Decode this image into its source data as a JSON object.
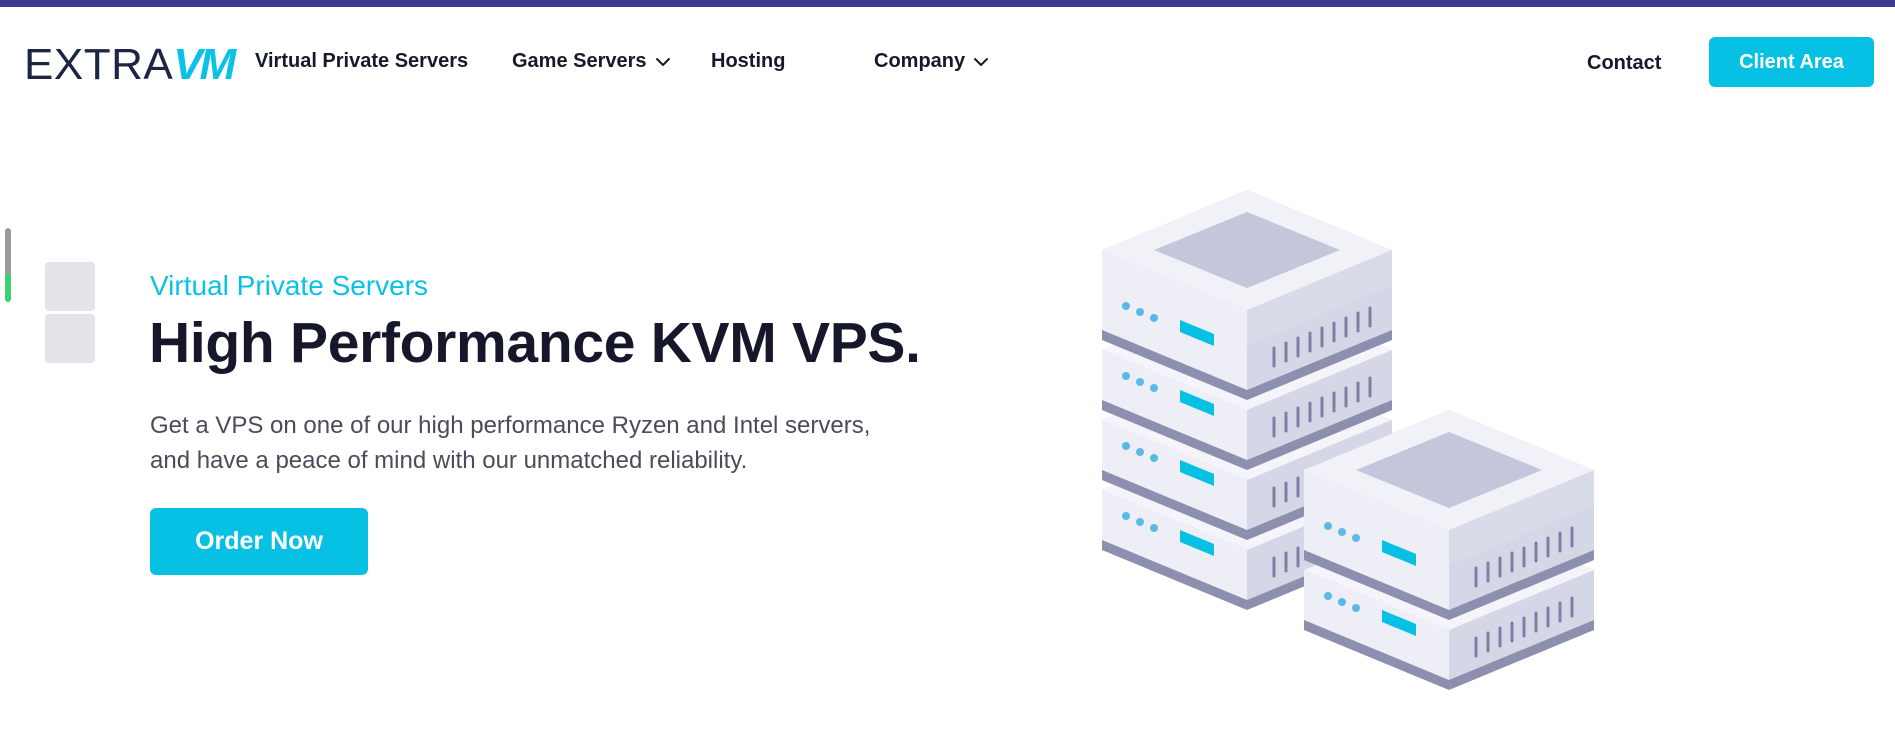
{
  "brand": {
    "logo_left": "EXTRA",
    "logo_right": "VM"
  },
  "nav": {
    "items": [
      {
        "label": "Virtual Private Servers",
        "has_dropdown": false
      },
      {
        "label": "Game Servers",
        "has_dropdown": true
      },
      {
        "label": "Hosting",
        "has_dropdown": false
      },
      {
        "label": "Company",
        "has_dropdown": true
      }
    ],
    "contact_label": "Contact",
    "client_area_label": "Client Area"
  },
  "hero": {
    "eyebrow": "Virtual Private Servers",
    "headline": "High Performance KVM VPS.",
    "description_line1": "Get a VPS on one of our high performance Ryzen and Intel servers,",
    "description_line2": "and have a peace of mind with our unmatched reliability.",
    "cta_label": "Order Now"
  },
  "icons": {
    "chevron": "chevron-down-icon",
    "illustration": "server-stack-icon"
  },
  "colors": {
    "accent": "#07c1e4",
    "topbar": "#3c3a8c",
    "text_dark": "#16172b",
    "text_body": "#4a4c5c"
  }
}
